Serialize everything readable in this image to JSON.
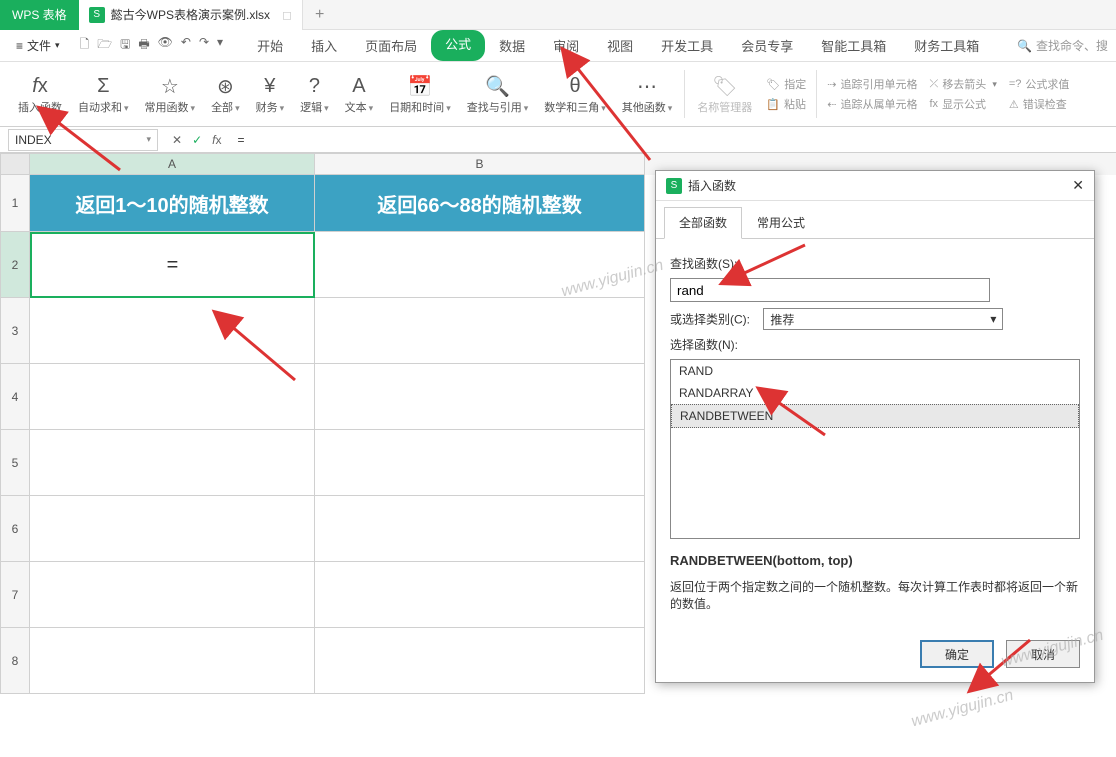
{
  "title_tabs": {
    "app": "WPS 表格",
    "doc": "懿古今WPS表格演示案例.xlsx",
    "plus": "+"
  },
  "menu": {
    "file": "文件",
    "tabs": [
      "开始",
      "插入",
      "页面布局",
      "公式",
      "数据",
      "审阅",
      "视图",
      "开发工具",
      "会员专享",
      "智能工具箱",
      "财务工具箱"
    ],
    "active_tab": "公式",
    "search": "查找命令、搜"
  },
  "ribbon": {
    "insert_fn": "插入函数",
    "autosum": "自动求和",
    "common": "常用函数",
    "all": "全部",
    "finance": "财务",
    "logic": "逻辑",
    "text": "文本",
    "datetime": "日期和时间",
    "lookup": "查找与引用",
    "math": "数学和三角",
    "other": "其他函数",
    "name_mgr": "名称管理器",
    "paste": "粘贴",
    "assign": "指定",
    "trace_pre": "追踪引用单元格",
    "trace_dep": "追踪从属单元格",
    "remove_arrow": "移去箭头",
    "show_formula": "显示公式",
    "formula_eval": "公式求值",
    "error_check": "错误检查"
  },
  "formula_bar": {
    "name": "INDEX",
    "value": "="
  },
  "columns": [
    "A",
    "B"
  ],
  "rows": [
    "1",
    "2",
    "3",
    "4",
    "5",
    "6",
    "7",
    "8"
  ],
  "cells": {
    "a1": "返回1～10的随机整数",
    "b1": "返回66～88的随机整数",
    "a2": "="
  },
  "dialog": {
    "title": "插入函数",
    "tab_all": "全部函数",
    "tab_common": "常用公式",
    "search_label": "查找函数(S):",
    "search_value": "rand",
    "cat_label": "或选择类别(C):",
    "cat_value": "推荐",
    "select_label": "选择函数(N):",
    "functions": [
      "RAND",
      "RANDARRAY",
      "RANDBETWEEN"
    ],
    "selected_fn": "RANDBETWEEN",
    "signature": "RANDBETWEEN(bottom, top)",
    "description": "返回位于两个指定数之间的一个随机整数。每次计算工作表时都将返回一个新的数值。",
    "ok": "确定",
    "cancel": "取消"
  },
  "watermarks": [
    "www.yigujin.cn",
    "www.yigujin.cn",
    "www.yigujin.cn"
  ]
}
